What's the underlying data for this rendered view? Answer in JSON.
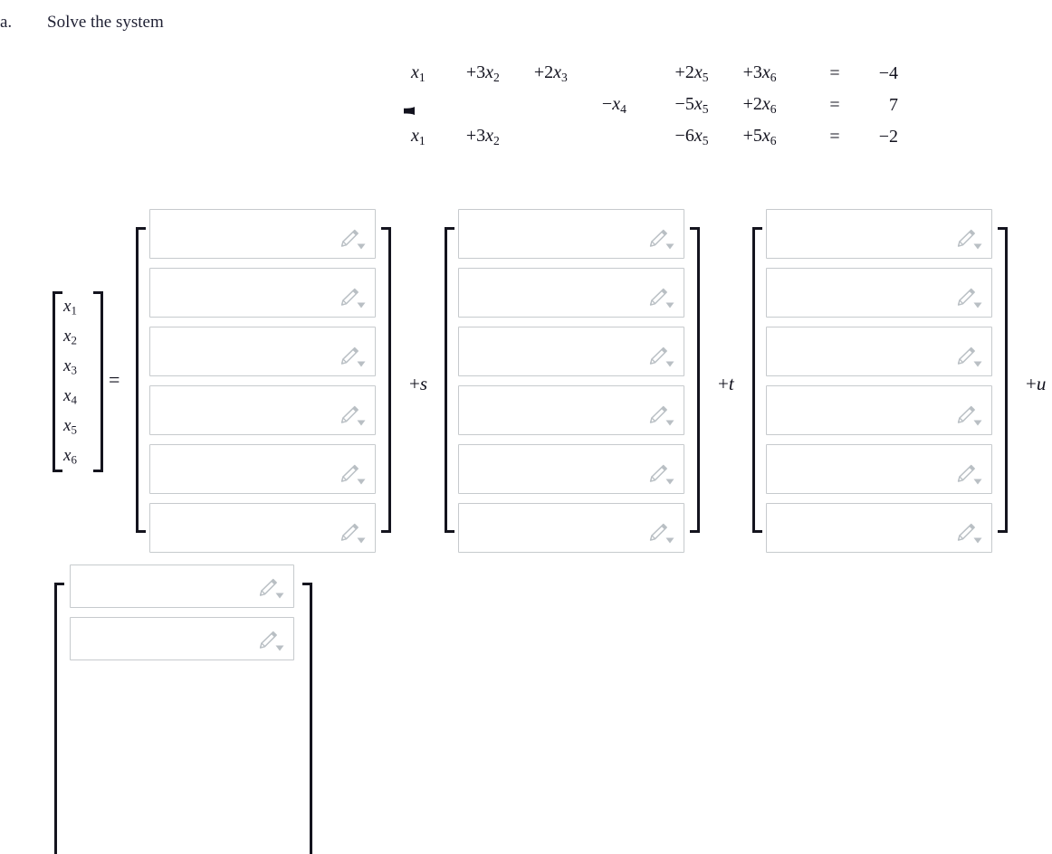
{
  "prompt": {
    "label": "a.",
    "text": "Solve the system"
  },
  "system": {
    "brace": "{",
    "equations": [
      {
        "terms": [
          "x1",
          "+3x2",
          "+2x3",
          "",
          "+2x5",
          "+3x6"
        ],
        "parts": [
          {
            "sign": "",
            "coef": "",
            "var": "x",
            "sub": "1"
          },
          {
            "sign": "+",
            "coef": "3",
            "var": "x",
            "sub": "2"
          },
          {
            "sign": "+",
            "coef": "2",
            "var": "x",
            "sub": "3"
          },
          {
            "sign": "",
            "coef": "",
            "var": "",
            "sub": ""
          },
          {
            "sign": "+",
            "coef": "2",
            "var": "x",
            "sub": "5"
          },
          {
            "sign": "+",
            "coef": "3",
            "var": "x",
            "sub": "6"
          }
        ],
        "equals": "=",
        "rhs": "−4"
      },
      {
        "terms": [
          "",
          "",
          "",
          "−x4",
          "−5x5",
          "+2x6"
        ],
        "parts": [
          {
            "sign": "",
            "coef": "",
            "var": "",
            "sub": ""
          },
          {
            "sign": "",
            "coef": "",
            "var": "",
            "sub": ""
          },
          {
            "sign": "",
            "coef": "",
            "var": "",
            "sub": ""
          },
          {
            "sign": "−",
            "coef": "",
            "var": "x",
            "sub": "4"
          },
          {
            "sign": "−",
            "coef": "5",
            "var": "x",
            "sub": "5"
          },
          {
            "sign": "+",
            "coef": "2",
            "var": "x",
            "sub": "6"
          }
        ],
        "equals": "=",
        "rhs": "7"
      },
      {
        "terms": [
          "x1",
          "+3x2",
          "",
          "",
          "−6x5",
          "+5x6"
        ],
        "parts": [
          {
            "sign": "",
            "coef": "",
            "var": "x",
            "sub": "1"
          },
          {
            "sign": "+",
            "coef": "3",
            "var": "x",
            "sub": "2"
          },
          {
            "sign": "",
            "coef": "",
            "var": "",
            "sub": ""
          },
          {
            "sign": "",
            "coef": "",
            "var": "",
            "sub": ""
          },
          {
            "sign": "−",
            "coef": "6",
            "var": "x",
            "sub": "5"
          },
          {
            "sign": "+",
            "coef": "5",
            "var": "x",
            "sub": "6"
          }
        ],
        "equals": "=",
        "rhs": "−2"
      }
    ]
  },
  "solution": {
    "unknown_vector": {
      "entries": [
        {
          "var": "x",
          "sub": "1"
        },
        {
          "var": "x",
          "sub": "2"
        },
        {
          "var": "x",
          "sub": "3"
        },
        {
          "var": "x",
          "sub": "4"
        },
        {
          "var": "x",
          "sub": "5"
        },
        {
          "var": "x",
          "sub": "6"
        }
      ]
    },
    "equals_sign": "=",
    "connectors": [
      {
        "sign": "+",
        "param": "s"
      },
      {
        "sign": "+",
        "param": "t"
      },
      {
        "sign": "+",
        "param": "u"
      }
    ],
    "vectors": [
      {
        "name": "particular-solution-vector",
        "cells": [
          {
            "value": "",
            "placeholder": ""
          },
          {
            "value": "",
            "placeholder": ""
          },
          {
            "value": "",
            "placeholder": ""
          },
          {
            "value": "",
            "placeholder": ""
          },
          {
            "value": "",
            "placeholder": ""
          },
          {
            "value": "",
            "placeholder": ""
          }
        ]
      },
      {
        "name": "s-basis-vector",
        "cells": [
          {
            "value": "",
            "placeholder": ""
          },
          {
            "value": "",
            "placeholder": ""
          },
          {
            "value": "",
            "placeholder": ""
          },
          {
            "value": "",
            "placeholder": ""
          },
          {
            "value": "",
            "placeholder": ""
          },
          {
            "value": "",
            "placeholder": ""
          }
        ]
      },
      {
        "name": "t-basis-vector",
        "cells": [
          {
            "value": "",
            "placeholder": ""
          },
          {
            "value": "",
            "placeholder": ""
          },
          {
            "value": "",
            "placeholder": ""
          },
          {
            "value": "",
            "placeholder": ""
          },
          {
            "value": "",
            "placeholder": ""
          },
          {
            "value": "",
            "placeholder": ""
          }
        ]
      }
    ],
    "overflow_vector": {
      "name": "u-basis-vector",
      "cells": [
        {
          "value": "",
          "placeholder": ""
        },
        {
          "value": "",
          "placeholder": ""
        }
      ]
    }
  },
  "icons": {
    "editor_pencil": "pencil-icon",
    "editor_dropdown": "chevron-down-icon"
  },
  "colors": {
    "text": "#1a1a28",
    "box_border": "#c6cacd",
    "bracket": "#14141e",
    "icon_gray": "#b9bfc4",
    "background": "#ffffff"
  }
}
